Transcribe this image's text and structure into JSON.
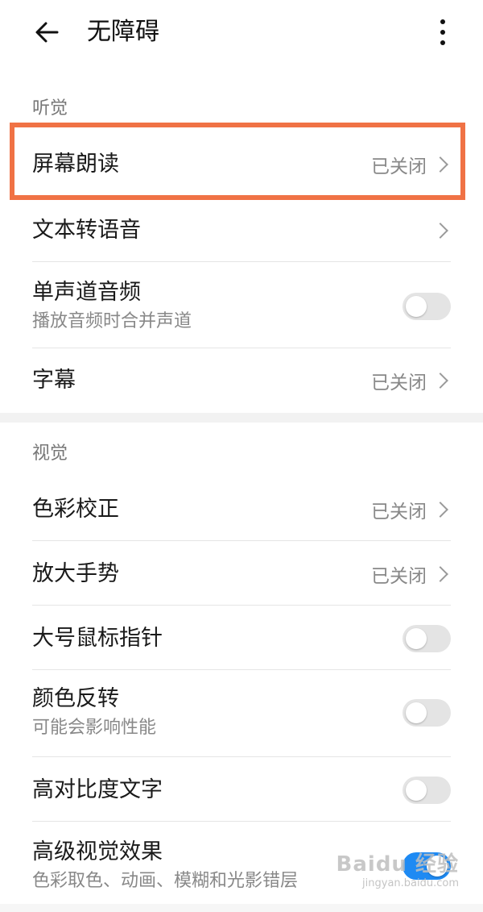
{
  "header": {
    "title": "无障碍",
    "back_icon": "arrow-left-icon",
    "more_icon": "more-vertical-icon"
  },
  "sections": [
    {
      "header": "听觉",
      "items": [
        {
          "title": "屏幕朗读",
          "status": "已关闭",
          "control": "chevron"
        },
        {
          "title": "文本转语音",
          "status": "",
          "control": "chevron"
        },
        {
          "title": "单声道音频",
          "subtitle": "播放音频时合并声道",
          "control": "toggle",
          "toggle_on": false
        },
        {
          "title": "字幕",
          "status": "已关闭",
          "control": "chevron"
        }
      ]
    },
    {
      "header": "视觉",
      "items": [
        {
          "title": "色彩校正",
          "status": "已关闭",
          "control": "chevron"
        },
        {
          "title": "放大手势",
          "status": "已关闭",
          "control": "chevron"
        },
        {
          "title": "大号鼠标指针",
          "control": "toggle",
          "toggle_on": false
        },
        {
          "title": "颜色反转",
          "subtitle": "可能会影响性能",
          "control": "toggle",
          "toggle_on": false
        },
        {
          "title": "高对比度文字",
          "control": "toggle",
          "toggle_on": false
        },
        {
          "title": "高级视觉效果",
          "subtitle": "色彩取色、动画、模糊和光影错层",
          "control": "toggle",
          "toggle_on": true
        }
      ]
    }
  ],
  "watermark": {
    "logo": "Baidu 经验",
    "url": "jingyan.baidu.com"
  },
  "colors": {
    "highlight": "#f07245",
    "toggle_on": "#1e8af3",
    "toggle_off": "#e4e4e4"
  }
}
